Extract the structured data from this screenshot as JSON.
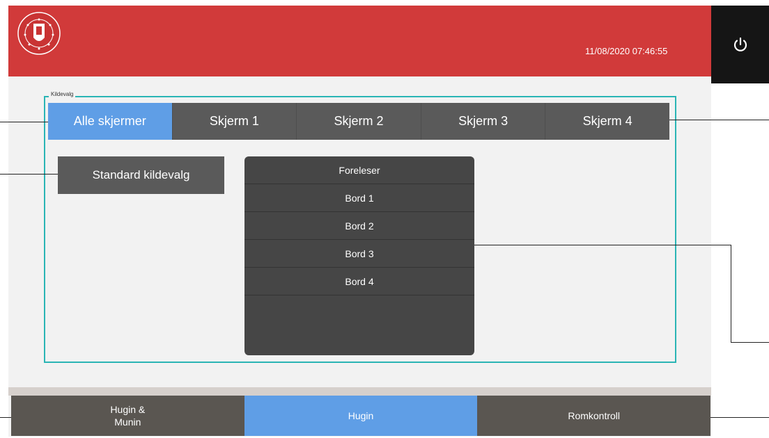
{
  "header": {
    "datetime": "11/08/2020 07:46:55",
    "logo_icon": "university-seal-logo",
    "power_icon": "power-icon",
    "colors": {
      "header": "#d13a3a",
      "power_box": "#151515"
    }
  },
  "source_group": {
    "label": "Kildevalg",
    "tabs": [
      {
        "label": "Alle skjermer",
        "active": true
      },
      {
        "label": "Skjerm 1",
        "active": false
      },
      {
        "label": "Skjerm 2",
        "active": false
      },
      {
        "label": "Skjerm 3",
        "active": false
      },
      {
        "label": "Skjerm 4",
        "active": false
      }
    ],
    "standard_button": "Standard kildevalg",
    "sources": [
      "Foreleser",
      "Bord 1",
      "Bord 2",
      "Bord 3",
      "Bord 4"
    ],
    "colors": {
      "active": "#5f9ee6",
      "inactive": "#5a5a5a",
      "border": "#2ab5b5"
    }
  },
  "footer": {
    "tabs": [
      {
        "line1": "Hugin &",
        "line2": "Munin",
        "active": false
      },
      {
        "line1": "Hugin",
        "line2": "",
        "active": true
      },
      {
        "line1": "Romkontroll",
        "line2": "",
        "active": false
      }
    ]
  }
}
